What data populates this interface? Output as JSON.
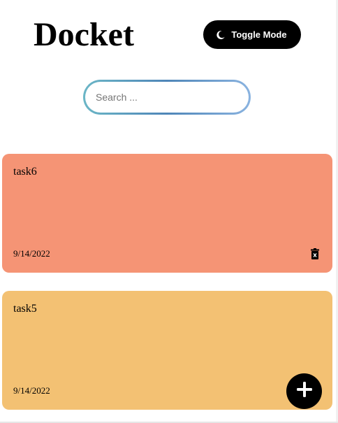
{
  "header": {
    "title": "Docket",
    "toggle_label": "Toggle Mode",
    "toggle_icon": "moon-icon"
  },
  "search": {
    "placeholder": "Search ...",
    "value": ""
  },
  "notes": [
    {
      "text": "task6",
      "date": "9/14/2022",
      "color": "#f59475"
    },
    {
      "text": "task5",
      "date": "9/14/2022",
      "color": "#f3c173"
    }
  ],
  "actions": {
    "add_icon": "plus-icon",
    "delete_icon": "trash-icon"
  },
  "colors": {
    "background": "#ffffff",
    "button": "#000000",
    "search_gradient": [
      "#6bb6c6",
      "#4f86b8",
      "#8ab3e0"
    ]
  }
}
